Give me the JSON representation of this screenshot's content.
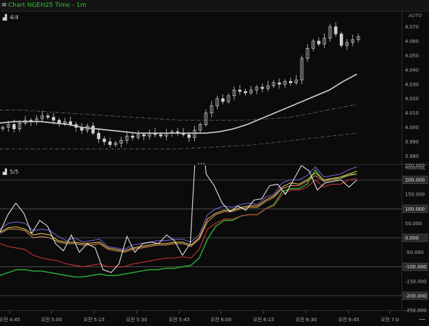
{
  "window": {
    "title": "Chart NGEH25 Time - 1m",
    "menu_icon": "hamburger-icon"
  },
  "price_panel": {
    "label": "4/4",
    "scale_mode": "AUTO",
    "y_ticks": [
      "4.070",
      "4.060",
      "4.050",
      "4.040",
      "4.030",
      "4.020",
      "4.010",
      "4.000",
      "3.990",
      "3.980"
    ]
  },
  "indicator_panel": {
    "label": "5/5",
    "scale_mode": "MANUAL",
    "y_ticks": [
      "250.000",
      "200.000",
      "150.000",
      "100.000",
      "50.000",
      "0.000",
      "-50.000",
      "-100.000",
      "-150.000",
      "-200.000",
      "-250.000"
    ],
    "boxed_ticks": [
      "200.000",
      "100.000",
      "0.000",
      "-100.000",
      "-200.000"
    ]
  },
  "x_axis": {
    "ticks": [
      "오전 4:45",
      "오전 5:00",
      "오전 5:15",
      "오전 5:30",
      "오전 5:45",
      "오전 6:00",
      "오전 6:15",
      "오전 6:30",
      "오전 6:45",
      "오전 7:0"
    ]
  },
  "controls": {
    "zoom_out": "—"
  },
  "colors": {
    "title": "#32c832",
    "background": "#0b0b0b",
    "candle": "#d0d0d0",
    "ma": "#bdbdbd"
  },
  "chart_data": [
    {
      "type": "candlestick",
      "ylim": [
        3.975,
        4.08
      ],
      "close": [
        4.0,
        4.002,
        3.999,
        4.003,
        4.005,
        4.004,
        4.006,
        4.008,
        4.007,
        4.005,
        4.003,
        4.004,
        4.002,
        4.0,
        3.998,
        4.001,
        3.996,
        3.992,
        3.99,
        3.988,
        3.989,
        3.991,
        3.994,
        3.993,
        3.995,
        3.994,
        3.996,
        3.995,
        3.994,
        3.996,
        3.997,
        3.996,
        3.995,
        3.993,
        3.998,
        4.002,
        4.01,
        4.015,
        4.02,
        4.018,
        4.022,
        4.026,
        4.025,
        4.024,
        4.026,
        4.028,
        4.027,
        4.029,
        4.031,
        4.03,
        4.032,
        4.031,
        4.033,
        4.048,
        4.055,
        4.06,
        4.058,
        4.062,
        4.07,
        4.065,
        4.057,
        4.059,
        4.061,
        4.063
      ],
      "ma_slow": [
        4.003,
        4.004,
        4.004,
        4.004,
        4.003,
        4.002,
        4.0,
        3.999,
        3.998,
        3.997,
        3.996,
        3.996,
        3.996,
        3.996,
        3.996,
        3.996,
        3.997,
        3.999,
        4.002,
        4.006,
        4.01,
        4.014,
        4.018,
        4.022,
        4.026,
        4.032,
        4.037
      ],
      "envelope_upper": [
        4.012,
        4.012,
        4.011,
        4.01,
        4.009,
        4.008,
        4.007,
        4.006,
        4.005,
        4.005,
        4.005,
        4.005,
        4.006,
        4.007,
        4.01,
        4.013,
        4.016
      ],
      "envelope_lower": [
        3.985,
        3.985,
        3.985,
        3.985,
        3.985,
        3.985,
        3.985,
        3.985,
        3.986,
        3.987,
        3.988,
        3.99,
        3.992,
        3.994,
        3.996
      ]
    },
    {
      "type": "line",
      "ylim": [
        -250,
        250
      ],
      "x": [
        0,
        1,
        2,
        3,
        4,
        5,
        6,
        7,
        8,
        9,
        10,
        11,
        12,
        13,
        14,
        15,
        16,
        17,
        18,
        19,
        20,
        21,
        22,
        23,
        24,
        25,
        26,
        27,
        28,
        29,
        30,
        31,
        32
      ],
      "series": [
        {
          "color": "#e8e8e8",
          "values": [
            20,
            80,
            120,
            85,
            15,
            60,
            40,
            -20,
            -45,
            10,
            -50,
            -20,
            -35,
            -110,
            -120,
            -90,
            5,
            -50,
            -20,
            -15,
            -20,
            10,
            -10,
            -60,
            -20,
            470,
            220,
            180,
            120,
            90,
            110,
            95,
            130,
            135,
            180,
            185,
            150,
            200,
            250,
            230,
            165,
            190,
            195,
            200,
            175,
            200
          ]
        },
        {
          "color": "#7a5cc8",
          "values": [
            30,
            50,
            55,
            50,
            25,
            30,
            25,
            5,
            -10,
            0,
            -15,
            -10,
            -5,
            -30,
            -35,
            -40,
            -25,
            -20,
            -15,
            -10,
            -10,
            -5,
            -5,
            -15,
            10,
            80,
            100,
            110,
            105,
            115,
            120,
            115,
            140,
            150,
            190,
            200,
            200,
            215,
            245,
            210,
            215,
            220,
            235,
            245
          ]
        },
        {
          "color": "#e0c84b",
          "values": [
            20,
            35,
            38,
            30,
            10,
            15,
            10,
            -10,
            -15,
            -15,
            -20,
            -18,
            -15,
            -35,
            -40,
            -45,
            -35,
            -30,
            -25,
            -20,
            -20,
            -15,
            -15,
            -25,
            0,
            65,
            85,
            95,
            95,
            105,
            110,
            110,
            130,
            145,
            175,
            190,
            185,
            200,
            225,
            200,
            205,
            210,
            220,
            230
          ]
        },
        {
          "color": "#d8885a",
          "values": [
            15,
            30,
            30,
            25,
            0,
            5,
            0,
            -15,
            -20,
            -20,
            -25,
            -25,
            -20,
            -40,
            -45,
            -50,
            -40,
            -35,
            -30,
            -25,
            -25,
            -20,
            -20,
            -30,
            -5,
            55,
            80,
            90,
            90,
            100,
            105,
            105,
            125,
            140,
            170,
            180,
            180,
            195,
            215,
            195,
            200,
            205,
            215,
            220
          ]
        },
        {
          "color": "#cc3434",
          "values": [
            -20,
            -30,
            -35,
            -40,
            -60,
            -70,
            -75,
            -80,
            -90,
            -95,
            -100,
            -95,
            -90,
            -100,
            -100,
            -100,
            -90,
            -85,
            -80,
            -75,
            -70,
            -70,
            -65,
            -70,
            -40,
            30,
            50,
            65,
            65,
            75,
            80,
            80,
            100,
            110,
            150,
            165,
            165,
            175,
            200,
            175,
            185,
            185,
            200,
            205
          ]
        },
        {
          "color": "#2aa53a",
          "values": [
            -130,
            -120,
            -110,
            -110,
            -115,
            -115,
            -120,
            -125,
            -130,
            -135,
            -135,
            -130,
            -125,
            -130,
            -130,
            -125,
            -120,
            -115,
            -110,
            -110,
            -105,
            -105,
            -100,
            -95,
            -70,
            -5,
            40,
            60,
            60,
            75,
            80,
            80,
            100,
            115,
            160,
            170,
            170,
            185,
            235,
            195,
            205,
            205,
            220,
            220
          ]
        }
      ]
    }
  ]
}
